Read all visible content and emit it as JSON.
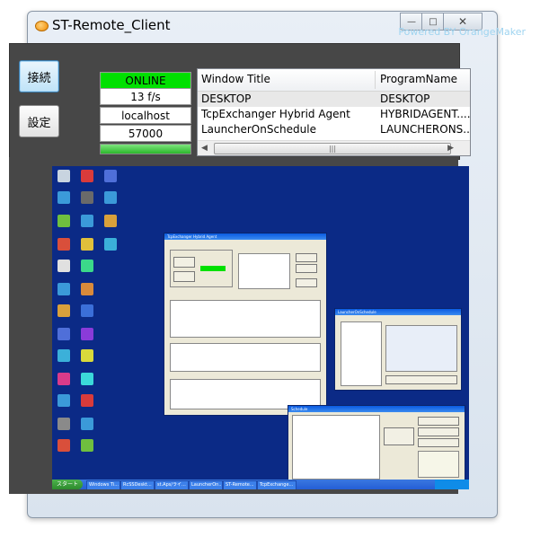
{
  "window": {
    "title": "ST-Remote_Client",
    "powered_by": "Powered  BY  OrangeMaker"
  },
  "controls": {
    "connect_label": "接続",
    "settings_label": "設定"
  },
  "status": {
    "connection": "ONLINE",
    "fps": "13 f/s",
    "host": "localhost",
    "port": "57000",
    "progress_fraction": 1.0
  },
  "window_list": {
    "columns": [
      "Window Title",
      "ProgramName"
    ],
    "rows": [
      {
        "title": "DESKTOP",
        "program": "DESKTOP"
      },
      {
        "title": "TcpExchanger Hybrid Agent",
        "program": "HYBRIDAGENT...."
      },
      {
        "title": "LauncherOnSchedule",
        "program": "LAUNCHERONS...."
      }
    ]
  },
  "remote_desktop": {
    "background_color": "#0b2a86",
    "start_label": "スタート",
    "taskbar_items": [
      "Windows Ti...",
      "RcSSDeskt...",
      "st.Aps/ライ...",
      "LauncherOn...",
      "ST-Remote...",
      "TcpExchange..."
    ]
  },
  "colors": {
    "online": "#00e000",
    "panel_bg": "#474747"
  }
}
